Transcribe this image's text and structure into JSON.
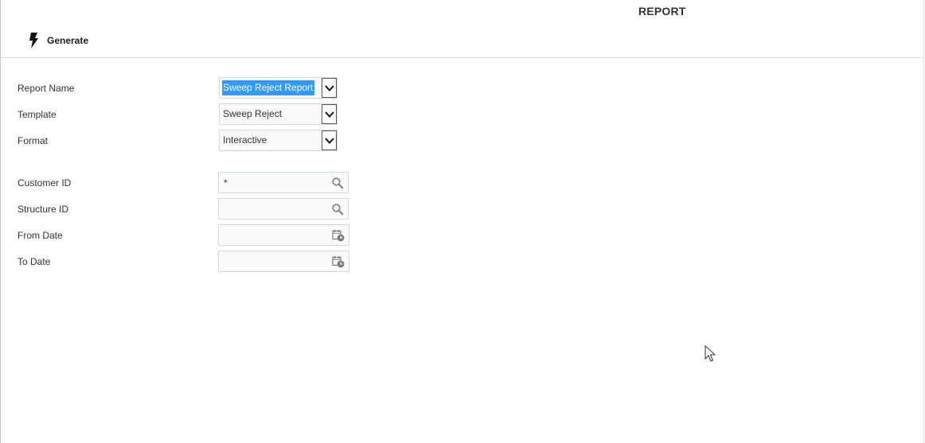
{
  "page": {
    "title": "REPORT"
  },
  "toolbar": {
    "generate_label": "Generate"
  },
  "form": {
    "report_name": {
      "label": "Report Name",
      "value": "Sweep Reject Report"
    },
    "template": {
      "label": "Template",
      "value": "Sweep Reject"
    },
    "format": {
      "label": "Format",
      "value": "Interactive"
    },
    "customer_id": {
      "label": "Customer ID",
      "value": "*"
    },
    "structure_id": {
      "label": "Structure ID",
      "value": ""
    },
    "from_date": {
      "label": "From Date",
      "value": ""
    },
    "to_date": {
      "label": "To Date",
      "value": ""
    }
  },
  "icons": {
    "generate": "lightning-bolt-icon",
    "lookup": "search-icon",
    "date": "calendar-clock-icon",
    "dropdown": "chevron-down-icon"
  },
  "colors": {
    "selection": "#3399ff",
    "field_border": "#d6dbe0",
    "field_bg": "#f8fafc"
  }
}
